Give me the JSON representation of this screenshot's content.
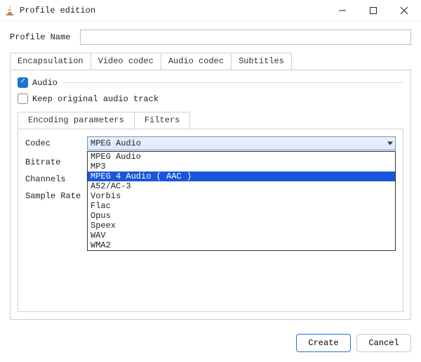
{
  "window": {
    "title": "Profile edition"
  },
  "profile": {
    "name_label": "Profile Name",
    "name_value": ""
  },
  "outer_tabs": {
    "encapsulation": "Encapsulation",
    "video_codec": "Video codec",
    "audio_codec": "Audio codec",
    "subtitles": "Subtitles",
    "active": "audio_codec"
  },
  "audio": {
    "label": "Audio",
    "checked": true,
    "keep_original_label": "Keep original audio track",
    "keep_original_checked": false
  },
  "inner_tabs": {
    "encoding": "Encoding parameters",
    "filters": "Filters",
    "active": "encoding"
  },
  "params": {
    "codec_label": "Codec",
    "bitrate_label": "Bitrate",
    "channels_label": "Channels",
    "sample_rate_label": "Sample Rate",
    "codec_value": "MPEG Audio"
  },
  "codec_dropdown": {
    "open": true,
    "highlight_index": 2,
    "options": [
      "MPEG Audio",
      "MP3",
      "MPEG 4 Audio ( AAC )",
      "A52/AC-3",
      "Vorbis",
      "Flac",
      "Opus",
      "Speex",
      "WAV",
      "WMA2"
    ]
  },
  "footer": {
    "create": "Create",
    "cancel": "Cancel"
  }
}
